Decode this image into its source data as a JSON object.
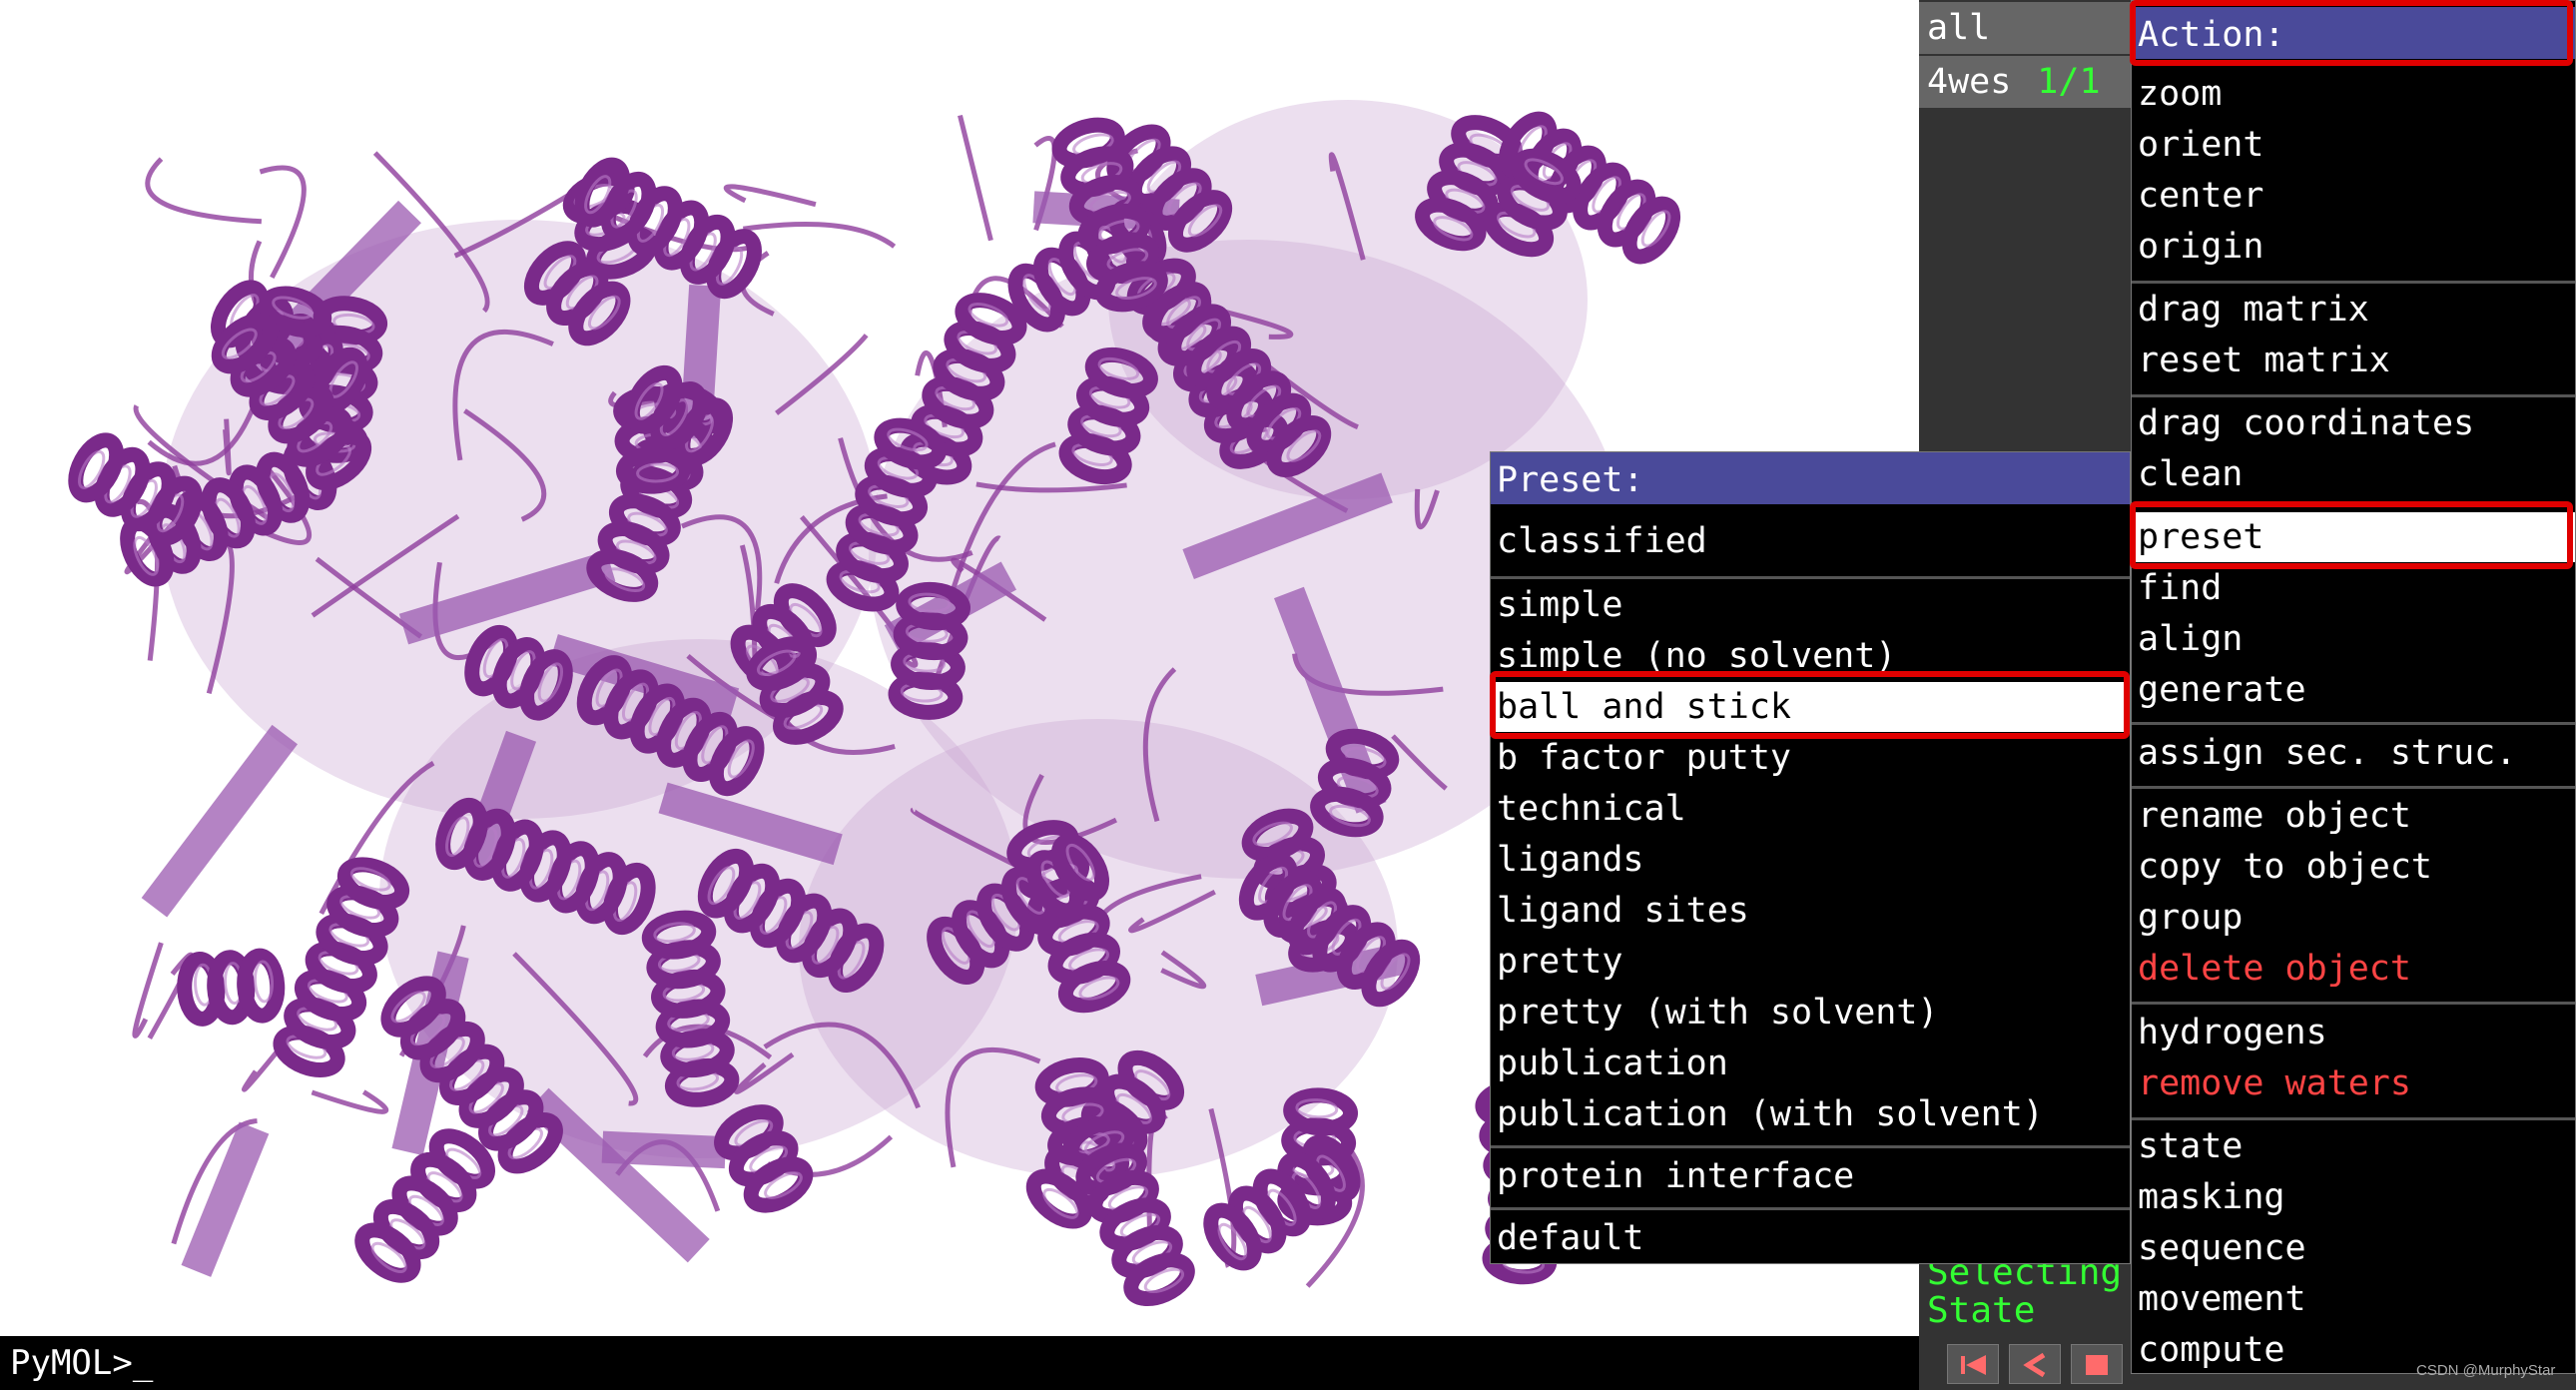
{
  "object_panel": {
    "all_label": "all",
    "object_name": "4wes",
    "object_state": "1/1",
    "status_line1": "Selecting",
    "status_line2": "State"
  },
  "command_line": {
    "prompt": "PyMOL>_"
  },
  "action_menu": {
    "title": "Action:",
    "items": [
      {
        "label": "zoom"
      },
      {
        "label": "orient"
      },
      {
        "label": "center"
      },
      {
        "label": "origin"
      },
      {
        "label": "drag matrix"
      },
      {
        "label": "reset matrix"
      },
      {
        "label": "drag coordinates"
      },
      {
        "label": "clean"
      },
      {
        "label": "preset"
      },
      {
        "label": "find"
      },
      {
        "label": "align"
      },
      {
        "label": "generate"
      },
      {
        "label": "assign sec. struc."
      },
      {
        "label": "rename object"
      },
      {
        "label": "copy to object"
      },
      {
        "label": "group"
      },
      {
        "label": "delete object"
      },
      {
        "label": "hydrogens"
      },
      {
        "label": "remove waters"
      },
      {
        "label": "state"
      },
      {
        "label": "masking"
      },
      {
        "label": "sequence"
      },
      {
        "label": "movement"
      },
      {
        "label": "compute"
      }
    ]
  },
  "preset_menu": {
    "title": "Preset:",
    "items": [
      {
        "label": "classified"
      },
      {
        "label": "simple"
      },
      {
        "label": "simple (no solvent)"
      },
      {
        "label": "ball and stick"
      },
      {
        "label": "b factor putty"
      },
      {
        "label": "technical"
      },
      {
        "label": "ligands"
      },
      {
        "label": "ligand sites"
      },
      {
        "label": "pretty"
      },
      {
        "label": "pretty (with solvent)"
      },
      {
        "label": "publication"
      },
      {
        "label": "publication (with solvent)"
      },
      {
        "label": "protein interface"
      },
      {
        "label": "default"
      }
    ]
  },
  "playback": {
    "buttons": [
      "rewind-icon",
      "step-back-icon",
      "stop-icon"
    ]
  },
  "colors": {
    "protein": "#7a2a8a",
    "menu_title_bg": "#4a4a9a",
    "highlight_red": "#e00000",
    "status_green": "#33ff33",
    "destructive_red": "#ff4444"
  },
  "watermark": "CSDN @MurphyStar"
}
